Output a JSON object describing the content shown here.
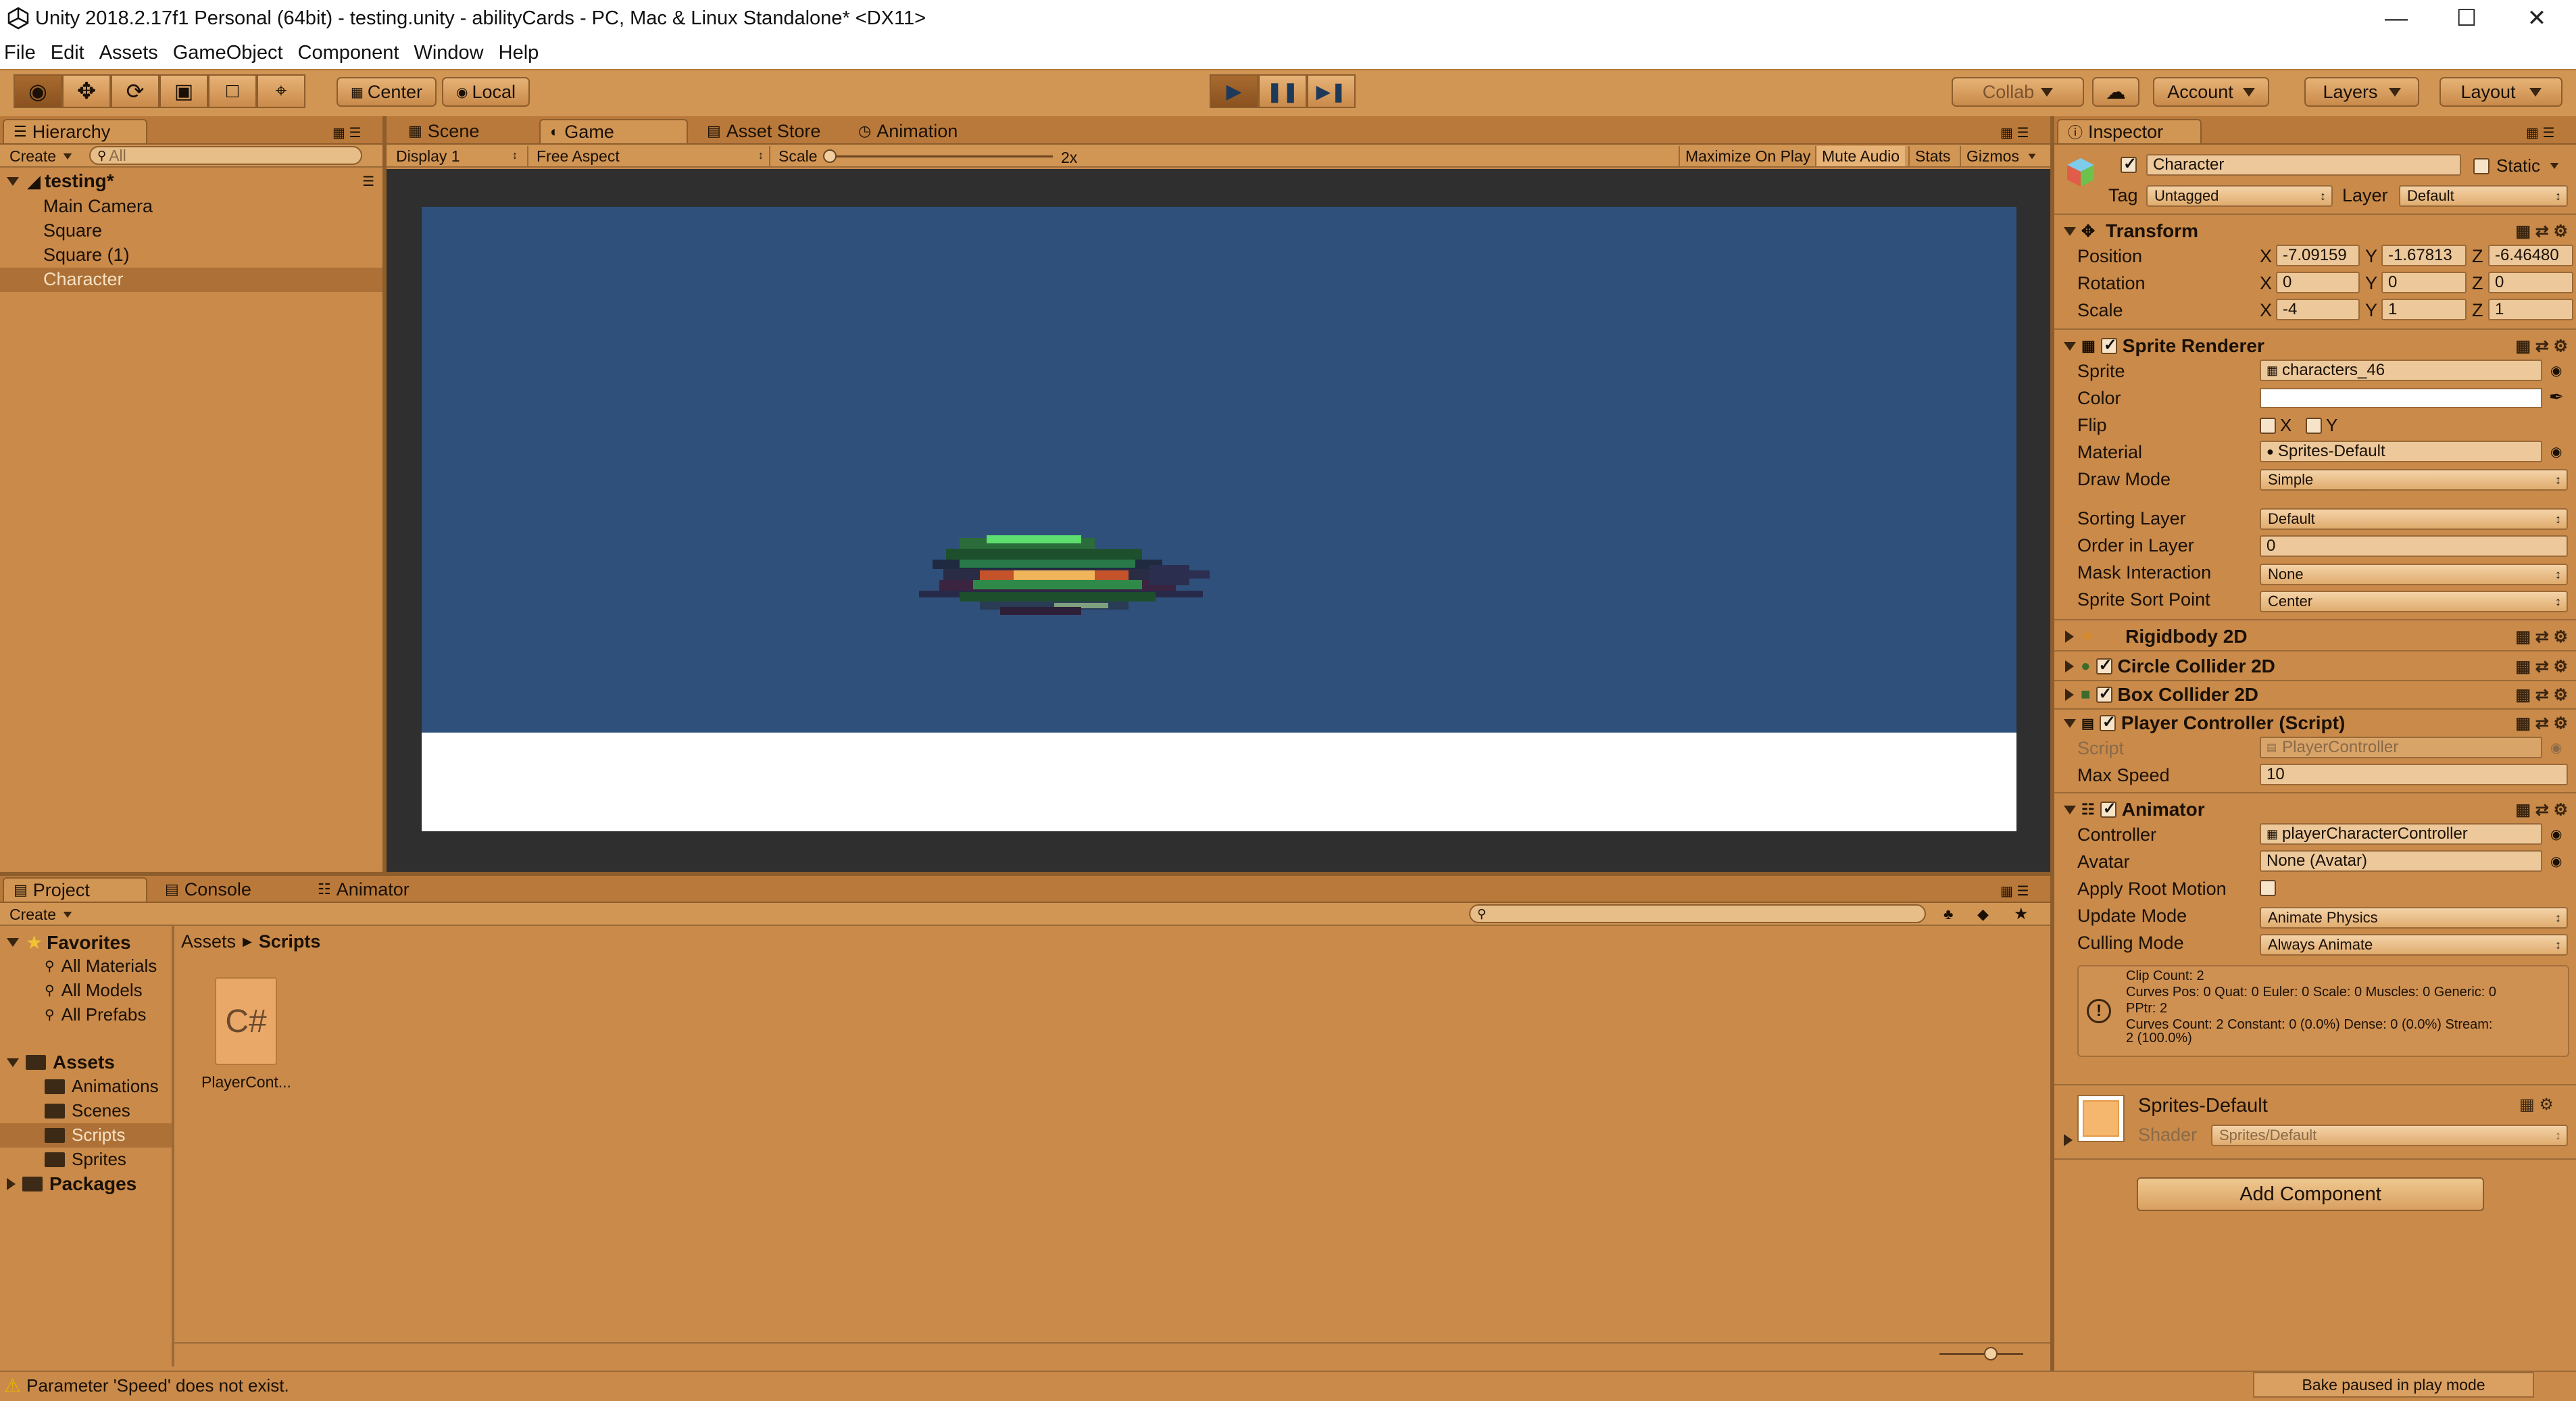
{
  "window": {
    "title": "Unity 2018.2.17f1 Personal (64bit) - testing.unity - abilityCards - PC, Mac & Linux Standalone* <DX11>",
    "minimize": "—",
    "maximize": "☐",
    "close": "✕"
  },
  "menu": [
    "File",
    "Edit",
    "Assets",
    "GameObject",
    "Component",
    "Window",
    "Help"
  ],
  "toolbar": {
    "pivot": "Center",
    "space": "Local",
    "collab": "Collab",
    "account": "Account",
    "layers": "Layers",
    "layout": "Layout"
  },
  "hierarchy": {
    "tab": "Hierarchy",
    "create": "Create",
    "search_placeholder": "All",
    "scene": "testing*",
    "items": [
      "Main Camera",
      "Square",
      "Square (1)",
      "Character"
    ]
  },
  "center_tabs": [
    "Scene",
    "Game",
    "Asset Store",
    "Animation"
  ],
  "game": {
    "display": "Display 1",
    "aspect": "Free Aspect",
    "scale_label": "Scale",
    "scale_value": "2x",
    "maximize": "Maximize On Play",
    "mute": "Mute Audio",
    "stats": "Stats",
    "gizmos": "Gizmos",
    "sky_color": "#30507c",
    "ground_color": "#ffffff"
  },
  "project": {
    "tabs": [
      "Project",
      "Console",
      "Animator"
    ],
    "create": "Create",
    "favorites": "Favorites",
    "favorite_items": [
      "All Materials",
      "All Models",
      "All Prefabs"
    ],
    "assets": "Assets",
    "asset_folders": [
      "Animations",
      "Scenes",
      "Scripts",
      "Sprites"
    ],
    "packages": "Packages",
    "breadcrumb_root": "Assets",
    "breadcrumb_current": "Scripts",
    "file_icon_text": "C#",
    "file_name": "PlayerCont..."
  },
  "inspector": {
    "tab": "Inspector",
    "object_name": "Character",
    "static_label": "Static",
    "tag_label": "Tag",
    "tag_value": "Untagged",
    "layer_label": "Layer",
    "layer_value": "Default",
    "transform": {
      "title": "Transform",
      "position_label": "Position",
      "rotation_label": "Rotation",
      "scale_label": "Scale",
      "position": [
        "-7.09159",
        "-1.67813",
        "-6.46480"
      ],
      "rotation": [
        "0",
        "0",
        "0"
      ],
      "scale": [
        "-4",
        "1",
        "1"
      ]
    },
    "sprite_renderer": {
      "title": "Sprite Renderer",
      "sprite_label": "Sprite",
      "sprite": "characters_46",
      "color_label": "Color",
      "flip_label": "Flip",
      "flip_x": "X",
      "flip_y": "Y",
      "material_label": "Material",
      "material": "Sprites-Default",
      "draw_mode_label": "Draw Mode",
      "draw_mode": "Simple",
      "sorting_layer_label": "Sorting Layer",
      "sorting_layer": "Default",
      "order_label": "Order in Layer",
      "order": "0",
      "mask_label": "Mask Interaction",
      "mask": "None",
      "sort_point_label": "Sprite Sort Point",
      "sort_point": "Center"
    },
    "rigidbody": "Rigidbody 2D",
    "circle_collider": "Circle Collider 2D",
    "box_collider": "Box Collider 2D",
    "player_controller": {
      "title": "Player Controller (Script)",
      "script_label": "Script",
      "script": "PlayerController",
      "max_speed_label": "Max Speed",
      "max_speed": "10"
    },
    "animator": {
      "title": "Animator",
      "controller_label": "Controller",
      "controller": "playerCharacterController",
      "avatar_label": "Avatar",
      "avatar": "None (Avatar)",
      "root_motion_label": "Apply Root Motion",
      "update_label": "Update Mode",
      "update": "Animate Physics",
      "culling_label": "Culling Mode",
      "culling": "Always Animate",
      "info": [
        "Clip Count: 2",
        "Curves Pos: 0 Quat: 0 Euler: 0 Scale: 0 Muscles: 0 Generic: 0",
        "PPtr: 2",
        "Curves Count: 2 Constant: 0 (0.0%) Dense: 0 (0.0%) Stream:",
        "2 (100.0%)"
      ]
    },
    "material": {
      "name": "Sprites-Default",
      "shader_label": "Shader",
      "shader": "Sprites/Default"
    },
    "add_component": "Add Component"
  },
  "status": {
    "message": "Parameter 'Speed' does not exist.",
    "bake": "Bake paused in play mode"
  }
}
